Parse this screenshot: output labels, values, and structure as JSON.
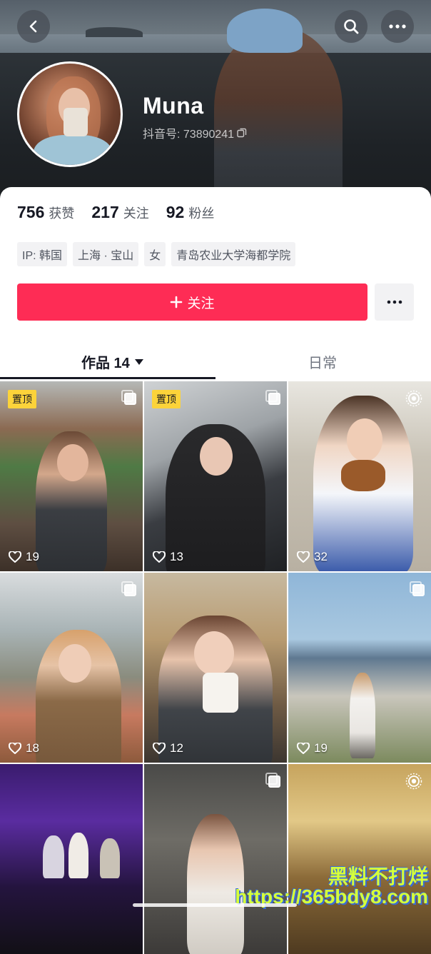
{
  "header": {
    "name": "Muna",
    "uid_label": "抖音号: 73890241"
  },
  "stats": [
    {
      "num": "756",
      "label": "获赞"
    },
    {
      "num": "217",
      "label": "关注"
    },
    {
      "num": "92",
      "label": "粉丝"
    }
  ],
  "tags": [
    "IP: 韩国",
    "上海 · 宝山",
    "女",
    "青岛农业大学海都学院"
  ],
  "follow_label": "关注",
  "tabs": {
    "works": "作品 14",
    "daily": "日常"
  },
  "grid": [
    {
      "pinned": true,
      "pin_label": "置顶",
      "likes": "19",
      "badge": "multi"
    },
    {
      "pinned": true,
      "pin_label": "置顶",
      "likes": "13",
      "badge": "multi"
    },
    {
      "pinned": false,
      "likes": "32",
      "badge": "live"
    },
    {
      "pinned": false,
      "likes": "18",
      "badge": "multi"
    },
    {
      "pinned": false,
      "likes": "12",
      "badge": "none"
    },
    {
      "pinned": false,
      "likes": "19",
      "badge": "multi"
    },
    {
      "pinned": false,
      "likes": "",
      "badge": "none"
    },
    {
      "pinned": false,
      "likes": "",
      "badge": "multi"
    },
    {
      "pinned": false,
      "likes": "",
      "badge": "live"
    }
  ],
  "watermark": {
    "line1": "黑料不打烊",
    "line2": "https://365bdy8.com"
  },
  "colors": {
    "accent": "#fe2c55",
    "pin": "#fcd33a"
  },
  "icons": [
    "back-icon",
    "search-icon",
    "more-icon",
    "copy-icon",
    "plus-icon",
    "dropdown-triangle-icon",
    "heart-icon",
    "multi-image-icon",
    "live-photo-icon"
  ]
}
